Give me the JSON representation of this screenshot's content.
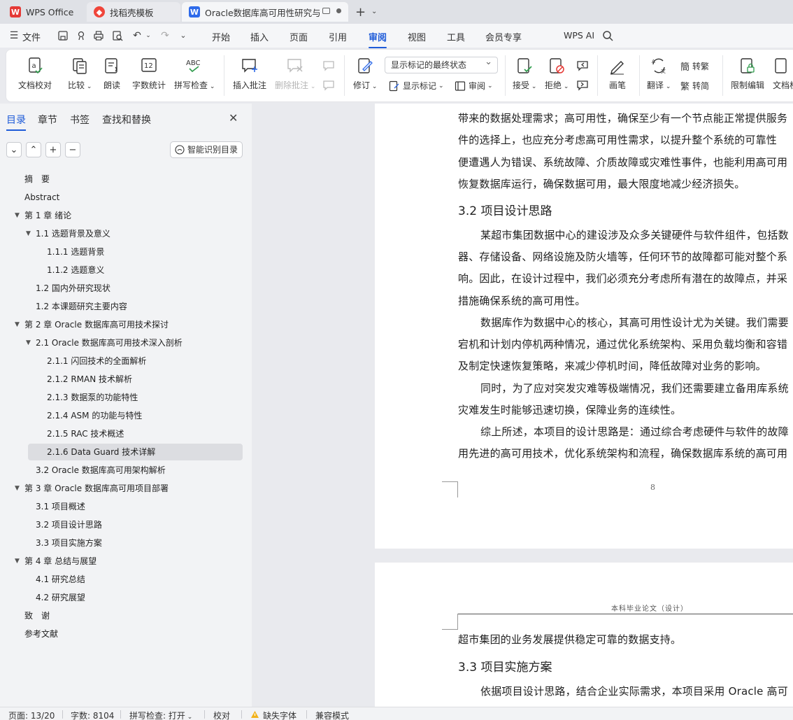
{
  "tabs": {
    "wps": "WPS Office",
    "daoke": "找稻壳模板",
    "doc": "Oracle数据库高可用性研究与"
  },
  "menu": {
    "file": "文件",
    "items": [
      "开始",
      "插入",
      "页面",
      "引用",
      "审阅",
      "视图",
      "工具",
      "会员专享"
    ],
    "ai": "WPS AI"
  },
  "ribbon": {
    "doc_check": "文档校对",
    "compare": "比较",
    "read_aloud": "朗读",
    "word_count": "字数统计",
    "spell_check": "拼写检查",
    "insert_comment": "插入批注",
    "delete_comment": "删除批注",
    "revise": "修订",
    "markup_select": "显示标记的最终状态",
    "show_markup": "显示标记",
    "review": "审阅",
    "accept": "接受",
    "reject": "拒绝",
    "pen": "画笔",
    "translate": "翻译",
    "to_trad": "转繁",
    "to_simp": "转简",
    "restrict_edit": "限制编辑",
    "doc_right": "文档权"
  },
  "panel": {
    "tabs": [
      "目录",
      "章节",
      "书签",
      "查找和替换"
    ],
    "smart_btn": "智能识别目录",
    "toc": [
      {
        "text": "摘　要",
        "level": 0
      },
      {
        "text": "Abstract",
        "level": 0
      },
      {
        "text": "第 1 章  绪论",
        "level": 0,
        "arrow": true
      },
      {
        "text": "1.1  选题背景及意义",
        "level": 1,
        "arrow": true
      },
      {
        "text": "1.1.1  选题背景",
        "level": 2
      },
      {
        "text": "1.1.2  选题意义",
        "level": 2
      },
      {
        "text": "1.2  国内外研究现状",
        "level": 1
      },
      {
        "text": "1.2 本课题研究主要内容",
        "level": 1
      },
      {
        "text": "第 2 章  Oracle 数据库高可用技术探讨",
        "level": 0,
        "arrow": true
      },
      {
        "text": "2.1 Oracle 数据库高可用技术深入剖析",
        "level": 1,
        "arrow": true
      },
      {
        "text": "2.1.1  闪回技术的全面解析",
        "level": 2
      },
      {
        "text": "2.1.2 RMAN 技术解析",
        "level": 2
      },
      {
        "text": "2.1.3  数据泵的功能特性",
        "level": 2
      },
      {
        "text": "2.1.4 ASM 的功能与特性",
        "level": 2
      },
      {
        "text": "2.1.5 RAC 技术概述",
        "level": 2
      },
      {
        "text": "2.1.6 Data Guard 技术详解",
        "level": 2
      },
      {
        "text": "3.2 Oracle 数据库高可用架构解析",
        "level": 1
      },
      {
        "text": "第 3 章  Oracle 数据库高可用项目部署",
        "level": 0,
        "arrow": true
      },
      {
        "text": "3.1  项目概述",
        "level": 1
      },
      {
        "text": "3.2  项目设计思路",
        "level": 1
      },
      {
        "text": "3.3  项目实施方案",
        "level": 1
      },
      {
        "text": "第 4 章  总结与展望",
        "level": 0,
        "arrow": true
      },
      {
        "text": "4.1  研究总结",
        "level": 1
      },
      {
        "text": "4.2  研究展望",
        "level": 1
      },
      {
        "text": "致　谢",
        "level": 0
      },
      {
        "text": "参考文献",
        "level": 0
      }
    ]
  },
  "document": {
    "page1": {
      "lines": [
        "带来的数据处理需求；高可用性，确保至少有一个节点能正常提供服务",
        "件的选择上，也应充分考虑高可用性需求，以提升整个系统的可靠性",
        "便遭遇人为错误、系统故障、介质故障或灾难性事件，也能利用高可用",
        "恢复数据库运行，确保数据可用，最大限度地减少经济损失。"
      ],
      "heading": "3.2  项目设计思路",
      "para2": [
        "某超市集团数据中心的建设涉及众多关键硬件与软件组件，包括数",
        "器、存储设备、网络设施及防火墙等，任何环节的故障都可能对整个系",
        "响。因此，在设计过程中，我们必须充分考虑所有潜在的故障点，并采",
        "措施确保系统的高可用性。"
      ],
      "para3": [
        "数据库作为数据中心的核心，其高可用性设计尤为关键。我们需要",
        "宕机和计划内停机两种情况，通过优化系统架构、采用负载均衡和容错",
        "及制定快速恢复策略，来减少停机时间，降低故障对业务的影响。"
      ],
      "para4": [
        "同时，为了应对突发灾难等极端情况，我们还需要建立备用库系统",
        "灾难发生时能够迅速切换，保障业务的连续性。"
      ],
      "para5": [
        "综上所述，本项目的设计思路是：通过综合考虑硬件与软件的故障",
        "用先进的高可用技术，优化系统架构和流程，确保数据库系统的高可用"
      ],
      "page_number": "8"
    },
    "page2": {
      "running_head": "本科毕业论文（设计）",
      "line1": "超市集团的业务发展提供稳定可靠的数据支持。",
      "heading": "3.3  项目实施方案",
      "line2": "依据项目设计思路，结合企业实际需求，本项目采用 Oracle 高可"
    }
  },
  "status": {
    "page": "页面: 13/20",
    "words": "字数: 8104",
    "spell": "拼写检查: 打开",
    "proof": "校对",
    "missing_font": "缺失字体",
    "compat": "兼容模式"
  },
  "colors": {
    "accent": "#1e5bd8",
    "wps_red": "#e53935"
  }
}
